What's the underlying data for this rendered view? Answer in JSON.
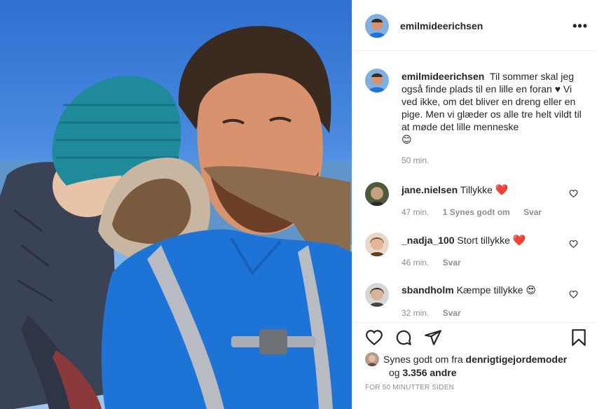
{
  "post": {
    "username": "emilmideerichsen",
    "more_icon": "more-horizontal-icon",
    "caption": "Til sommer skal jeg også finde plads til en lille en foran ♥ Vi ved ikke, om det bliver en dreng eller en pige. Men vi glæder os alle tre helt vildt til at møde det lille menneske",
    "caption_emoji": "😊",
    "caption_time": "50 min."
  },
  "comments": [
    {
      "username": "jane.nielsen",
      "text": "Tillykke",
      "emoji": "❤️",
      "time": "47 min.",
      "likes": "1 Synes godt om",
      "reply": "Svar"
    },
    {
      "username": "_nadja_100",
      "text": "Stort tillykke",
      "emoji": "❤️",
      "time": "46 min.",
      "likes": "",
      "reply": "Svar"
    },
    {
      "username": "sbandholm",
      "text": "Kæmpe tillykke",
      "emoji": "😍",
      "time": "32 min.",
      "likes": "",
      "reply": "Svar"
    }
  ],
  "actions": {
    "like_icon": "heart-icon",
    "comment_icon": "comment-icon",
    "share_icon": "send-icon",
    "save_icon": "bookmark-icon"
  },
  "likes_summary": {
    "prefix": "Synes godt om fra",
    "user": "denrigtigejordemoder",
    "joiner": "og",
    "count": "3.356 andre",
    "ago": "FOR 50 MINUTTER SIDEN"
  },
  "colors": {
    "text": "#262626",
    "muted": "#8e8e8e",
    "border": "#efefef",
    "heart": "#ed1c24"
  }
}
